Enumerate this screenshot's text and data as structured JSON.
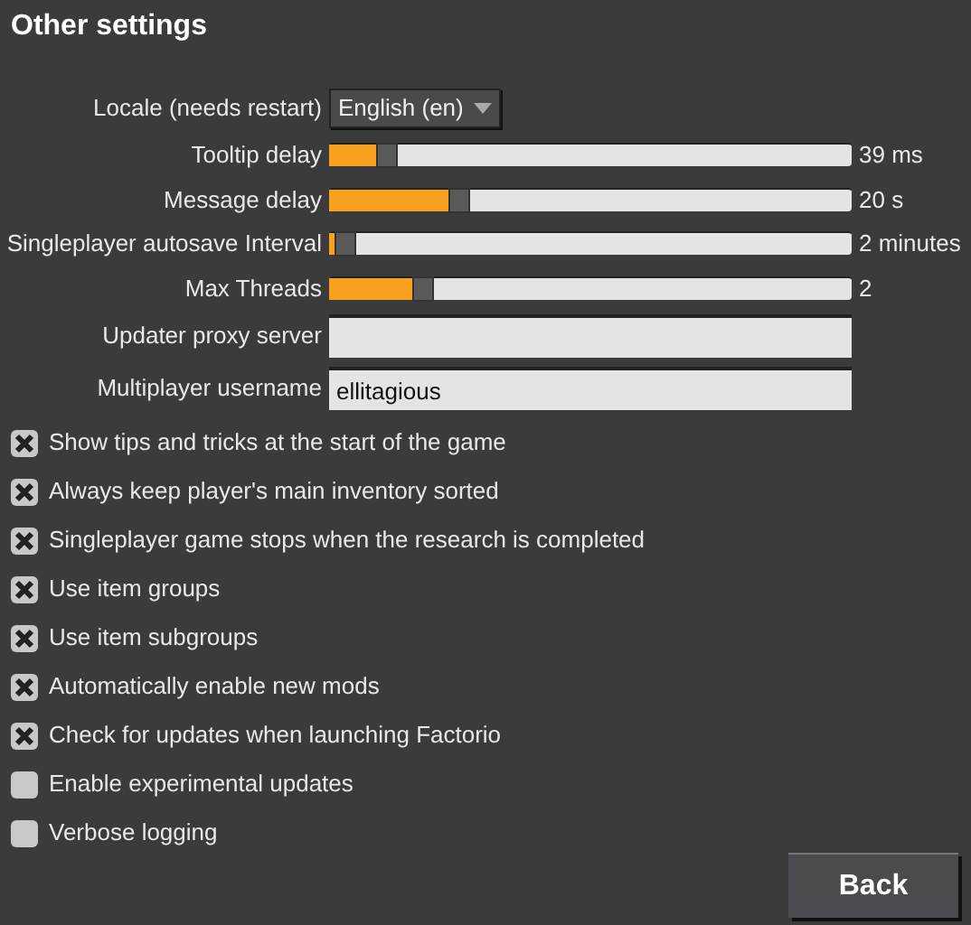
{
  "title": "Other settings",
  "locale": {
    "label": "Locale (needs restart)",
    "value": "English (en)"
  },
  "sliders": [
    {
      "label": "Tooltip delay",
      "level": 0.1,
      "reading": "39 ms"
    },
    {
      "label": "Message delay",
      "level": 0.24,
      "reading": "20 s"
    },
    {
      "label": "Singleplayer autosave Interval",
      "level": 0.02,
      "reading": "2 minutes"
    },
    {
      "label": "Max Threads",
      "level": 0.17,
      "reading": "2"
    }
  ],
  "fields": [
    {
      "label": "Updater proxy server"
    },
    {
      "label": "Multiplayer username",
      "value": "ellitagious"
    }
  ],
  "checkboxes": [
    {
      "label": "Show tips and tricks at the start of the game",
      "checked": true
    },
    {
      "label": "Always keep player's main inventory sorted",
      "checked": true
    },
    {
      "label": "Singleplayer game stops when the research is completed",
      "checked": true
    },
    {
      "label": "Use item groups",
      "checked": true
    },
    {
      "label": "Use item subgroups",
      "checked": true
    },
    {
      "label": "Automatically enable new mods",
      "checked": true
    },
    {
      "label": "Check for updates when launching Factorio",
      "checked": true
    },
    {
      "label": "Enable experimental updates",
      "checked": false
    },
    {
      "label": "Verbose logging",
      "checked": false
    }
  ],
  "back_button": "Back"
}
